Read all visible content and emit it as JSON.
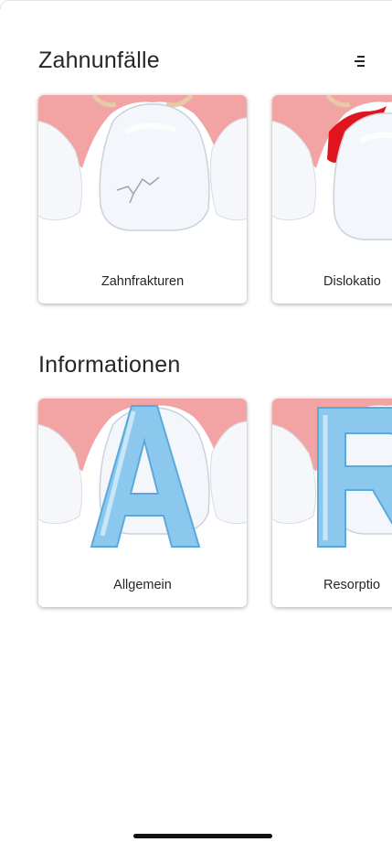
{
  "sections": {
    "accidents": {
      "title": "Zahnunfälle",
      "cards": [
        {
          "label": "Zahnfrakturen"
        },
        {
          "label": "Dislokatio"
        }
      ]
    },
    "info": {
      "title": "Informationen",
      "cards": [
        {
          "label": "Allgemein"
        },
        {
          "label": "Resorptio"
        }
      ]
    }
  },
  "icons": {
    "sort": "sort-icon"
  },
  "colors": {
    "gum": "#f2a3a3",
    "gum_dark": "#e06a6a",
    "blood": "#e0141e",
    "tooth": "#f4f7fb",
    "letter": "#8cc8ee"
  }
}
